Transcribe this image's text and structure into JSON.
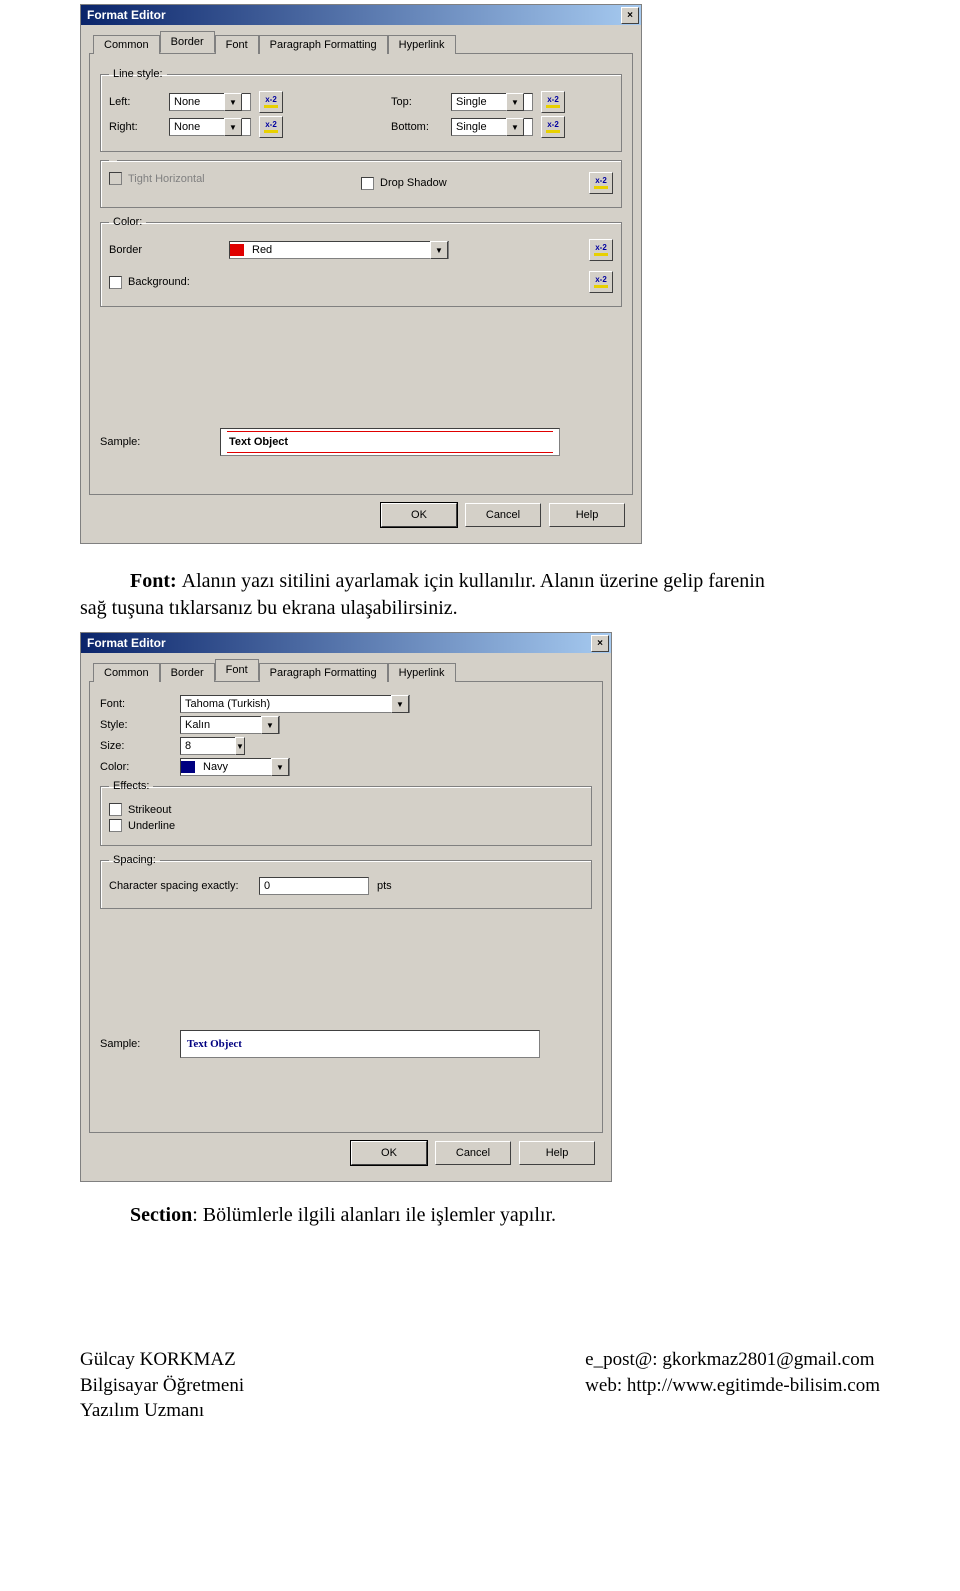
{
  "dialog1": {
    "title": "Format Editor",
    "close": "×",
    "tabs": [
      "Common",
      "Border",
      "Font",
      "Paragraph Formatting",
      "Hyperlink"
    ],
    "active_tab": "Border",
    "linestyle": {
      "legend": "Line style:",
      "left_label": "Left:",
      "left_value": "None",
      "right_label": "Right:",
      "right_value": "None",
      "top_label": "Top:",
      "top_value": "Single",
      "bottom_label": "Bottom:",
      "bottom_value": "Single"
    },
    "shadow": {
      "tight_label": "Tight Horizontal",
      "drop_label": "Drop Shadow"
    },
    "color": {
      "legend": "Color:",
      "border_label": "Border",
      "border_value": "Red",
      "border_swatch": "#e00000",
      "background_label": "Background:"
    },
    "sample_label": "Sample:",
    "sample_text": "Text Object",
    "buttons": {
      "ok": "OK",
      "cancel": "Cancel",
      "help": "Help"
    },
    "fx_label": "x-2"
  },
  "doc1": {
    "line1": "Font: Alanın yazı sitilini ayarlamak için kullanılır. Alanın üzerine gelip farenin",
    "line2": "sağ tuşuna tıklarsanız bu ekrana ulaşabilirsiniz."
  },
  "dialog2": {
    "title": "Format Editor",
    "close": "×",
    "tabs": [
      "Common",
      "Border",
      "Font",
      "Paragraph Formatting",
      "Hyperlink"
    ],
    "active_tab": "Font",
    "font_label": "Font:",
    "font_value": "Tahoma (Turkish)",
    "style_label": "Style:",
    "style_value": "Kalın",
    "size_label": "Size:",
    "size_value": "8",
    "color_label": "Color:",
    "color_value": "Navy",
    "color_swatch": "#000080",
    "effects": {
      "legend": "Effects:",
      "strikeout": "Strikeout",
      "underline": "Underline"
    },
    "spacing": {
      "legend": "Spacing:",
      "label": "Character spacing exactly:",
      "value": "0",
      "unit": "pts"
    },
    "sample_label": "Sample:",
    "sample_text": "Text Object",
    "buttons": {
      "ok": "OK",
      "cancel": "Cancel",
      "help": "Help"
    }
  },
  "section": {
    "bold": "Section",
    "rest": ": Bölümlerle ilgili alanları ile işlemler yapılır."
  },
  "footer": {
    "name": "Gülcay KORKMAZ",
    "role": "Bilgisayar Öğretmeni",
    "title": "Yazılım Uzmanı",
    "email_label": "e_post@: ",
    "email": "gkorkmaz2801@gmail.com",
    "web_label": "web:  ",
    "web": "http://www.egitimde-bilisim.com"
  }
}
